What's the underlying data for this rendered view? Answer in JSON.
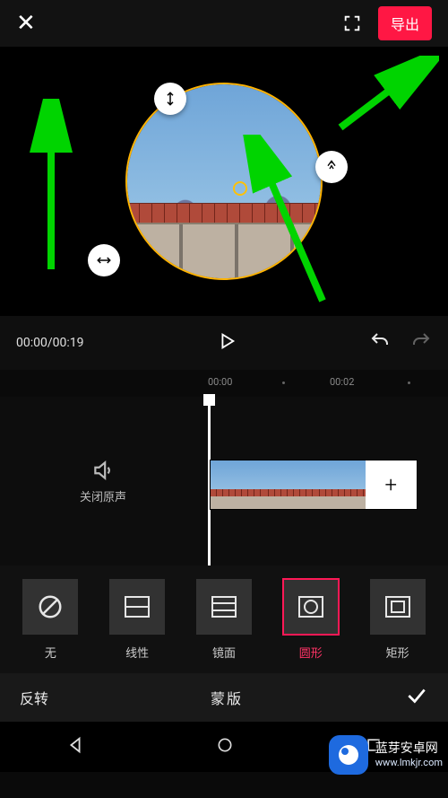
{
  "header": {
    "export_label": "导出"
  },
  "playback": {
    "current_time": "00:00",
    "total_time": "00:19"
  },
  "ruler": {
    "t0": "00:00",
    "t1": "00:02"
  },
  "mute": {
    "label": "关闭原声"
  },
  "mask_options": [
    {
      "id": "none",
      "label": "无",
      "icon": "none"
    },
    {
      "id": "linear",
      "label": "线性",
      "icon": "linear"
    },
    {
      "id": "mirror",
      "label": "镜面",
      "icon": "mirror"
    },
    {
      "id": "circle",
      "label": "圆形",
      "icon": "circle",
      "selected": true
    },
    {
      "id": "rect",
      "label": "矩形",
      "icon": "rect"
    }
  ],
  "toolbar": {
    "invert_label": "反转",
    "panel_title": "蒙版"
  },
  "watermark": {
    "title": "蓝芽安卓网",
    "url": "www.lmkjr.com"
  }
}
